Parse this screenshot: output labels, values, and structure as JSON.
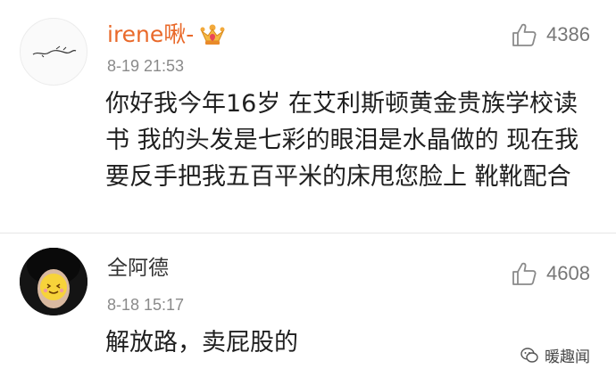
{
  "comments": [
    {
      "username": "irene啾-",
      "badge_icon": "crown-badge-icon",
      "timestamp": "8-19 21:53",
      "likes": "4386",
      "text": "你好我今年16岁 在艾利斯顿黄金贵族学校读书 我的头发是七彩的眼泪是水晶做的 现在我要反手把我五百平米的床甩您脸上 靴靴配合"
    },
    {
      "username": "全阿德",
      "timestamp": "8-18 15:17",
      "likes": "4608",
      "text": "解放路，卖屁股的"
    }
  ],
  "watermark": {
    "icon": "wechat-icon",
    "text": "暖趣闻"
  },
  "colors": {
    "username_highlight": "#e9692a",
    "meta_gray": "#8a8a8a",
    "text": "#1f1f1f"
  }
}
